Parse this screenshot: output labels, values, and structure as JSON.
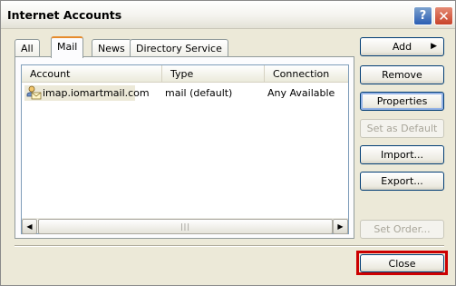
{
  "window": {
    "title": "Internet Accounts"
  },
  "titlebar_buttons": {
    "help": "?",
    "close": "✕"
  },
  "tabs": [
    {
      "label": "All",
      "active": false
    },
    {
      "label": "Mail",
      "active": true
    },
    {
      "label": "News",
      "active": false
    },
    {
      "label": "Directory Service",
      "active": false
    }
  ],
  "list": {
    "columns": [
      "Account",
      "Type",
      "Connection"
    ],
    "rows": [
      {
        "account": "imap.iomartmail.com",
        "type": "mail (default)",
        "connection": "Any Available",
        "icon": "mail-account-icon"
      }
    ]
  },
  "scrollbar": {
    "left_arrow": "◀",
    "right_arrow": "▶",
    "grip": "|||"
  },
  "buttons": {
    "add": "Add",
    "add_arrow": "▶",
    "remove": "Remove",
    "properties": "Properties",
    "set_default": "Set as Default",
    "import": "Import...",
    "export": "Export...",
    "set_order": "Set Order...",
    "close": "Close"
  },
  "colors": {
    "highlight": "#cc0000",
    "tab_accent": "#e68b2c"
  }
}
